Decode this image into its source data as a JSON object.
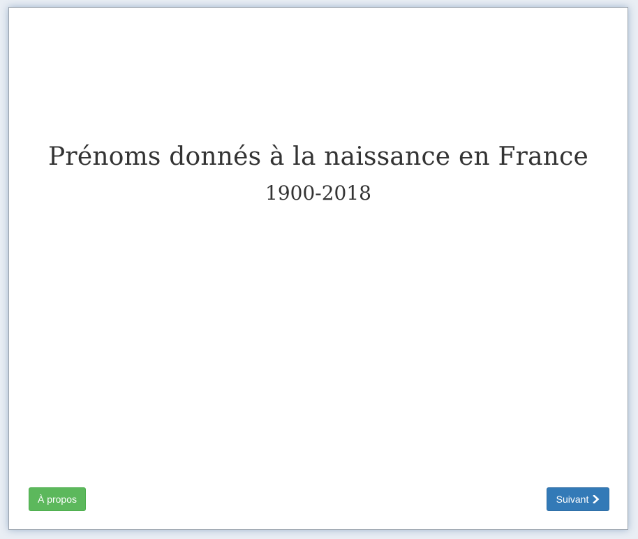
{
  "title": {
    "main": "Prénoms donnés à la naissance en France",
    "subtitle": "1900-2018"
  },
  "buttons": {
    "about_label": "À propos",
    "next_label": "Suivant",
    "next_icon": "chevron-right-icon"
  },
  "colors": {
    "about_button": "#5cb85c",
    "next_button": "#337ab7",
    "title_text": "#333333"
  }
}
